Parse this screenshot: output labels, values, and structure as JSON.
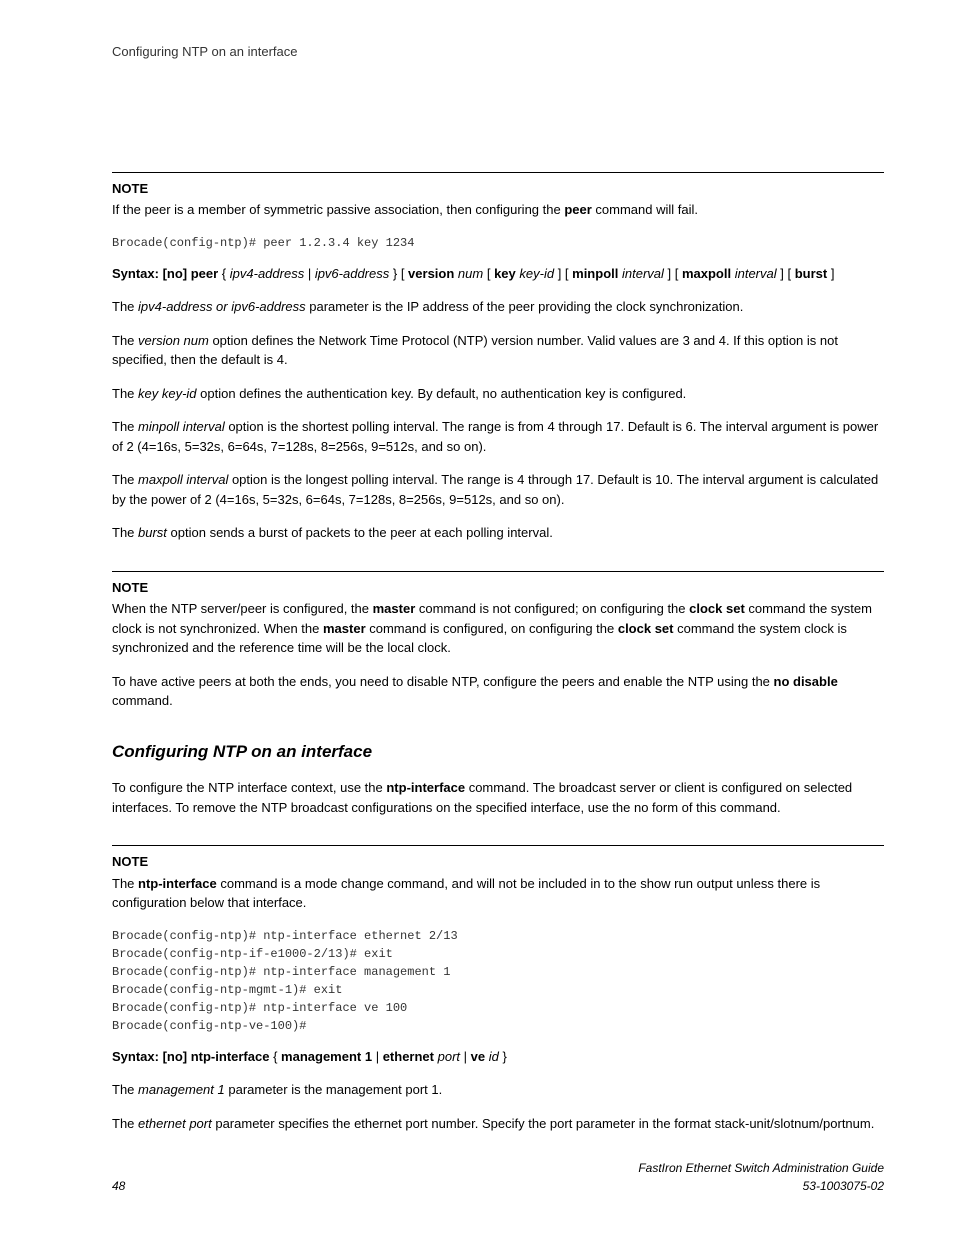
{
  "header": "Configuring NTP on an interface",
  "note1": {
    "label": "NOTE",
    "text_before": "If the peer is a member of symmetric passive association, then configuring the ",
    "text_bold": "peer",
    "text_after": " command will fail."
  },
  "code1": "Brocade(config-ntp)# peer 1.2.3.4 key 1234",
  "syntax1": {
    "s1": "Syntax: [no] peer",
    "s2": " { ",
    "s3": "ipv4-address",
    "s4": " | ",
    "s5": "ipv6-address",
    "s6": " } [ ",
    "s7": "version",
    "s8": " ",
    "s9": "num",
    "s10": " [ ",
    "s11": "key",
    "s12": " ",
    "s13": "key-id",
    "s14": " ] [ ",
    "s15": "minpoll",
    "s16": " ",
    "s17": "interval",
    "s18": " ] [ ",
    "s19": "maxpoll",
    "s20": " ",
    "s21": "interval",
    "s22": " ] [ ",
    "s23": "burst",
    "s24": " ]"
  },
  "p1": {
    "a": "The ",
    "b": "ipv4-address or ipv6-address",
    "c": " parameter is the IP address of the peer providing the clock synchronization."
  },
  "p2": {
    "a": "The ",
    "b": "version num",
    "c": " option defines the Network Time Protocol (NTP) version number. Valid values are 3 and 4. If this option is not specified, then the default is 4."
  },
  "p3": {
    "a": "The ",
    "b": "key key-id",
    "c": " option defines the authentication key. By default, no authentication key is configured."
  },
  "p4": {
    "a": "The ",
    "b": "minpoll interval",
    "c": " option is the shortest polling interval. The range is from 4 through 17. Default is 6. The interval argument is power of 2 (4=16s, 5=32s, 6=64s, 7=128s, 8=256s, 9=512s, and so on)."
  },
  "p5": {
    "a": "The ",
    "b": "maxpoll interval",
    "c": " option is the longest polling interval. The range is 4 through 17. Default is 10. The interval argument is calculated by the power of 2 (4=16s, 5=32s, 6=64s, 7=128s, 8=256s, 9=512s, and so on)."
  },
  "p6": {
    "a": "The ",
    "b": "burst",
    "c": " option sends a burst of packets to the peer at each polling interval."
  },
  "note2": {
    "label": "NOTE",
    "a": "When the NTP server/peer is configured, the ",
    "b": "master",
    "c": " command is not configured; on configuring the ",
    "d": "clock set",
    "e": " command the system clock is not synchronized. When the ",
    "f": "master",
    "g": " command is configured, on configuring the ",
    "h": "clock set",
    "i": " command the system clock is synchronized and the reference time will be the local clock."
  },
  "p7": {
    "a": "To have active peers at both the ends, you need to disable NTP, configure the peers and enable the NTP using the ",
    "b": "no disable",
    "c": " command."
  },
  "heading2": "Configuring NTP on an interface",
  "p8": {
    "a": "To configure the NTP interface context, use the ",
    "b": "ntp-interface",
    "c": " command. The broadcast server or client is configured on selected interfaces. To remove the NTP broadcast configurations on the specified interface, use the no form of this command."
  },
  "note3": {
    "label": "NOTE",
    "a": "The ",
    "b": "ntp-interface",
    "c": " command is a mode change command, and will not be included in to the show run output unless there is configuration below that interface."
  },
  "code2": "Brocade(config-ntp)# ntp-interface ethernet 2/13\nBrocade(config-ntp-if-e1000-2/13)# exit\nBrocade(config-ntp)# ntp-interface management 1\nBrocade(config-ntp-mgmt-1)# exit\nBrocade(config-ntp)# ntp-interface ve 100\nBrocade(config-ntp-ve-100)#",
  "syntax2": {
    "s1": "Syntax: [no] ntp-interface",
    "s2": " { ",
    "s3": "management 1",
    "s4": " | ",
    "s5": "ethernet",
    "s6": " ",
    "s7": "port",
    "s8": " | ",
    "s9": "ve",
    "s10": " ",
    "s11": "id",
    "s12": " }"
  },
  "p9": {
    "a": "The ",
    "b": "management 1",
    "c": " parameter is the management port 1."
  },
  "p10": {
    "a": "The ",
    "b": "ethernet port",
    "c": " parameter specifies the ethernet port number. Specify the port parameter in the format stack-unit/slotnum/portnum."
  },
  "footer": {
    "page": "48",
    "title": "FastIron Ethernet Switch Administration Guide",
    "docnum": "53-1003075-02"
  }
}
